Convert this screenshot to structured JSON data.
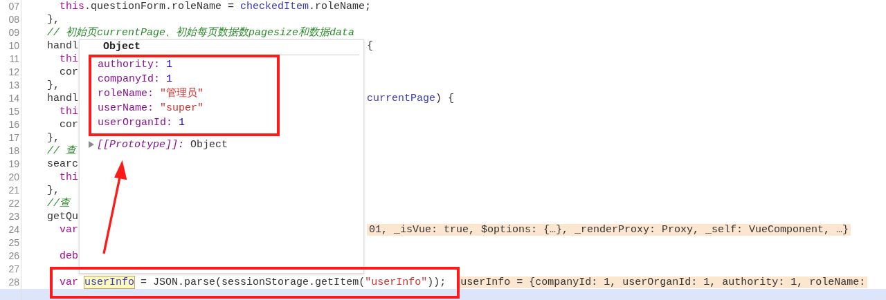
{
  "editor": {
    "lines": [
      {
        "number": "07",
        "paused": false,
        "left": [
          {
            "text": "    this",
            "kind": "keyword"
          },
          {
            "text": ".questionForm.roleName = ",
            "kind": "plain"
          },
          {
            "text": "checkedItem",
            "kind": "ident"
          },
          {
            "text": ".roleName;",
            "kind": "plain"
          }
        ]
      },
      {
        "number": "08",
        "paused": false,
        "left": [
          {
            "text": "  },",
            "kind": "plain"
          }
        ]
      },
      {
        "number": "09",
        "paused": false,
        "left": [
          {
            "text": "  // 初始页currentPage、初始每页数据数pagesize和数据data",
            "kind": "comment"
          }
        ]
      },
      {
        "number": "10",
        "paused": false,
        "left": [
          {
            "text": "  handl",
            "kind": "plain"
          }
        ],
        "right": [
          {
            "text": "{",
            "kind": "plain"
          }
        ]
      },
      {
        "number": "11",
        "paused": false,
        "left": [
          {
            "text": "    thi",
            "kind": "keyword"
          }
        ]
      },
      {
        "number": "12",
        "paused": false,
        "left": [
          {
            "text": "    cor",
            "kind": "plain"
          }
        ]
      },
      {
        "number": "13",
        "paused": false,
        "left": [
          {
            "text": "  },",
            "kind": "plain"
          }
        ]
      },
      {
        "number": "14",
        "paused": false,
        "left": [
          {
            "text": "  handl",
            "kind": "plain"
          }
        ],
        "right": [
          {
            "text": "currentPage",
            "kind": "ident"
          },
          {
            "text": ") {",
            "kind": "plain"
          }
        ]
      },
      {
        "number": "15",
        "paused": false,
        "left": [
          {
            "text": "    thi",
            "kind": "keyword"
          }
        ]
      },
      {
        "number": "16",
        "paused": false,
        "left": [
          {
            "text": "    cor",
            "kind": "plain"
          }
        ]
      },
      {
        "number": "17",
        "paused": false,
        "left": [
          {
            "text": "  },",
            "kind": "plain"
          }
        ]
      },
      {
        "number": "18",
        "paused": false,
        "left": [
          {
            "text": "  // 查",
            "kind": "comment"
          }
        ]
      },
      {
        "number": "19",
        "paused": false,
        "left": [
          {
            "text": "  searc",
            "kind": "plain"
          }
        ]
      },
      {
        "number": "20",
        "paused": false,
        "left": [
          {
            "text": "    thi",
            "kind": "keyword"
          }
        ]
      },
      {
        "number": "21",
        "paused": false,
        "left": [
          {
            "text": "  },",
            "kind": "plain"
          }
        ]
      },
      {
        "number": "22",
        "paused": false,
        "left": [
          {
            "text": "  //查",
            "kind": "comment"
          }
        ]
      },
      {
        "number": "23",
        "paused": false,
        "left": [
          {
            "text": "  getQu",
            "kind": "plain"
          }
        ]
      },
      {
        "number": "24",
        "paused": false,
        "left": [
          {
            "text": "    var",
            "kind": "keyword"
          }
        ],
        "right": [
          {
            "text": "01, _isVue: true, $options: {…}, _renderProxy: Proxy, _self: VueComponent, …}",
            "kind": "value"
          }
        ]
      },
      {
        "number": "25",
        "paused": false
      },
      {
        "number": "26",
        "paused": false,
        "left": [
          {
            "text": "    deb",
            "kind": "keyword"
          }
        ]
      },
      {
        "number": "27",
        "paused": false
      },
      {
        "number": "28",
        "paused": false,
        "left": [
          {
            "text": "    var",
            "kind": "keyword"
          },
          {
            "text": " userInfo",
            "kind": "hovered"
          },
          {
            "text": " = JSON.parse(sessionStorage.getItem(",
            "kind": "plain"
          },
          {
            "text": "\"userInfo\"",
            "kind": "string"
          },
          {
            "text": "));",
            "kind": "plain"
          }
        ],
        "after": [
          {
            "text": "userInfo = {companyId: 1, userOrganId: 1, authority: 1, roleName:",
            "kind": "value"
          }
        ]
      },
      {
        "paused": true
      }
    ]
  },
  "popup": {
    "title": "Object",
    "properties": [
      {
        "name": "authority:",
        "value": "1",
        "kind": "number"
      },
      {
        "name": "companyId:",
        "value": "1",
        "kind": "number"
      },
      {
        "name": "roleName:",
        "value": "\"管理员\"",
        "kind": "string"
      },
      {
        "name": "userName:",
        "value": "\"super\"",
        "kind": "string"
      },
      {
        "name": "userOrganId:",
        "value": "1",
        "kind": "number"
      }
    ],
    "prototype": {
      "label": "[[Prototype]]:",
      "value": "Object",
      "expanded": false
    }
  }
}
